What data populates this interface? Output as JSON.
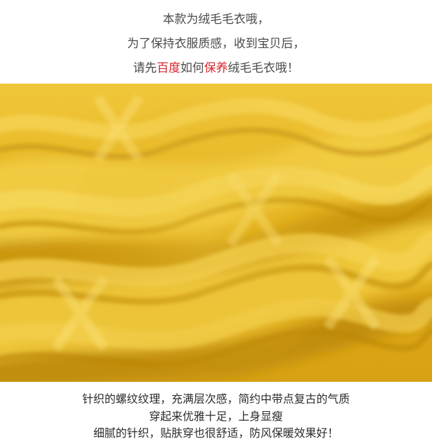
{
  "top": {
    "line1": "本款为绒毛毛衣哦，",
    "line2": "为了保持衣服质感，收到宝贝后，",
    "line3_a": "请先",
    "line3_b": "百度",
    "line3_c": "如何",
    "line3_d": "保养",
    "line3_e": "绒毛毛衣哦！"
  },
  "colors": {
    "highlight": "#d8232a",
    "knit_base": "#e3b21d",
    "knit_light": "#f3cf45",
    "knit_dark": "#b98a0c"
  },
  "bottom": {
    "line1": "针织的螺纹纹理，充满层次感，简约中带点复古的气质",
    "line2": "穿起来优雅十足，上身显瘦",
    "line3": "细腻的针织，贴肤穿也很舒适，防风保暖效果好！"
  }
}
